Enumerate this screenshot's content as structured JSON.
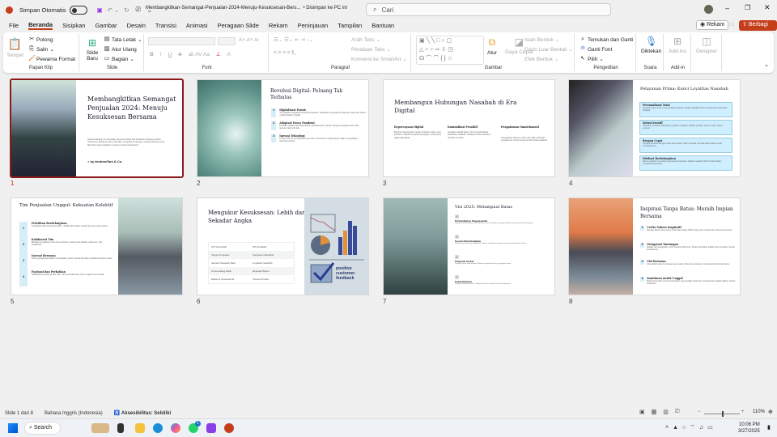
{
  "titlebar": {
    "autosave_label": "Simpan Otomatis",
    "filename": "Membangkitkan-Semangat-Penjualan-2024-Menuju-Kesuksesan-Bers...",
    "save_state": "• Disimpan ke PC ini",
    "search_placeholder": "Cari"
  },
  "tabs": [
    "File",
    "Beranda",
    "Sisipkan",
    "Gambar",
    "Desain",
    "Transisi",
    "Animasi",
    "Peragaan Slide",
    "Rekam",
    "Peninjauan",
    "Tampilan",
    "Bantuan"
  ],
  "actions": {
    "record": "Rekam",
    "share": "Berbagi"
  },
  "ribbon": {
    "clipboard": {
      "paste": "Tempel",
      "cut": "Potong",
      "copy": "Salin",
      "format_painter": "Pewarna Format",
      "label": "Papan Klip"
    },
    "slides": {
      "new_slide": "Slide Baru",
      "layout": "Tata Letak",
      "reset": "Atur Ulang",
      "section": "Bagian",
      "label": "Slide"
    },
    "font": {
      "label": "Font"
    },
    "paragraph": {
      "text_direction": "Arah Teks",
      "align_text": "Perataan Teks",
      "smartart": "Konversi ke SmartArt",
      "label": "Paragraf"
    },
    "drawing": {
      "arrange": "Atur",
      "quick_styles": "Gaya Cepat",
      "shape_fill": "Isian Bentuk",
      "shape_outline": "Garis Luar Bentuk",
      "shape_effects": "Efek Bentuk",
      "label": "Gambar"
    },
    "editing": {
      "find_replace": "Temukan dan Ganti",
      "replace_font": "Ganti Font",
      "select": "Pilih",
      "label": "Pengeditan"
    },
    "voice": {
      "dictate": "Diktekan",
      "label": "Suara"
    },
    "addins": {
      "addins": "Add-ins",
      "label": "Add-in"
    },
    "designer": {
      "designer": "Designer"
    }
  },
  "slides": [
    {
      "number": "1",
      "title": "Membangkitkan Semangat Penjualan 2024: Menuju Kesuksesan Bersama",
      "body": "Selamat datang, tim penjualan yang luar biasa! Kita berada di ambang revolusi perbankan. Bersama-sama, kita akan mengubah tantangan menjadi peluang emas. Mari kita mulai perjalanan menuju puncak kesuksesan!",
      "author": "by AndrewTani & Co."
    },
    {
      "number": "2",
      "title": "Revolusi Digital: Peluang Tak Terbatas",
      "items": [
        {
          "n": "1",
          "h": "Digitalisasi Penuh",
          "t": "Tren digital mengubah lanskap perbankan. Nasabah menginginkan layanan cepat dan efisien melalui platform digital."
        },
        {
          "n": "2",
          "h": "Adaptasi Pasca Pandemi",
          "t": "Perilaku nasabah berubah drastis. Mereka lebih nyaman dengan transaksi online dan layanan tanpa kontak."
        },
        {
          "n": "3",
          "h": "Inovasi Teknologi",
          "t": "Fintech dan AI membuka dimensi baru. Kita harus menjadi pionir dalam mengadopsi teknologi terbaru."
        }
      ]
    },
    {
      "number": "3",
      "title": "Membangun Hubungan Nasabah di Era Digital",
      "cols": [
        {
          "h": "Kepercayaan Digital",
          "t": "Bangun kepercayaan melalui interaksi online yang personal. Jadilah konsultan keuangan virtual yang dapat diandalkan."
        },
        {
          "h": "Komunikasi Proaktif",
          "t": "Gunakan analitik data untuk mengantisipasi kebutuhan nasabah. Tawarkan solusi sebelum mereka meminta."
        },
        {
          "h": "Pengalaman Omnichannel",
          "t": "Integrasikan layanan online dan offline. Berikan pengalaman mulus di semua titik kontak nasabah."
        }
      ]
    },
    {
      "number": "4",
      "title": "Pelayanan Prima: Kunci Loyalitas Nasabah",
      "items": [
        {
          "h": "Personalisasi Total",
          "t": "Gunakan data untuk menyesuaikan layanan. Setiap nasabah harus merasa dimengerti dan dihargai."
        },
        {
          "h": "Solusi Kreatif",
          "t": "Tawarkan produk berdasarkan perilaku nasabah. Jadilah problem solver, bukan hanya penjual."
        },
        {
          "h": "Respon Cepat",
          "t": "Tangani keluhan dengan cepat dan efektif. Ubah masalah menjadi kesempatan untuk mengesankan."
        },
        {
          "h": "Edukasi Berkelanjutan",
          "t": "Bantu nasabah memahami keputusan finansial. Jadikan nasabah lebih cerdas dalam mengelola keuangan."
        }
      ]
    },
    {
      "number": "5",
      "title": "Tim Penjualan Unggul: Kekuatan Kolektif",
      "items": [
        {
          "n": "1",
          "h": "Pelatihan Berkelanjutan",
          "t": "Tingkatkan skill secara konsisten. Jadilah ahli dalam produk dan tren pasar terkini."
        },
        {
          "n": "2",
          "h": "Kolaborasi Tim",
          "t": "Berbagi pengalaman dan best practices. Sukses kita adalah sukses tim, dan sebaliknya."
        },
        {
          "n": "3",
          "h": "Inovasi Bersama",
          "t": "Dorong kreativitas dalam menciptakan solusi. Setiap ide bisa menjadi terobosan besar."
        },
        {
          "n": "4",
          "h": "Evaluasi dan Perbaikan",
          "t": "Refleksikan kinerja secara rutin. Terus perbaiki diri untuk menjadi versi terbaik."
        }
      ]
    },
    {
      "number": "6",
      "title": "Mengukur Kesuksesan: Lebih dari Sekadar Angka",
      "table": [
        [
          "KPI Kuantitatif",
          "KPI Kualitatif"
        ],
        [
          "Target Penjualan",
          "Kepuasan Nasabah"
        ],
        [
          "Akuisisi Nasabah Baru",
          "Loyalitas Nasabah"
        ],
        [
          "Cross-selling Ratio",
          "Reputasi Brand"
        ],
        [
          "Efisiensi Operasional",
          "Inovasi Produk"
        ]
      ],
      "image_text": "positive customer feedback"
    },
    {
      "number": "7",
      "title": "Visi 2025: Melampaui Batas",
      "items": [
        {
          "h": "Pertumbuhan Eksponensial",
          "t": "Targetkan pertumbuhan 200% dalam 2 tahun. Setiap tantangan adalah peluang untuk berkembang."
        },
        {
          "h": "Inovasi Berkelanjutan",
          "t": "Ciptakan produk yang mengubah industri. Jadilah pemimpin, bukan pengikut dalam inovasi."
        },
        {
          "h": "Ekspansi Global",
          "t": "Jangkau pasar internasional. Bawa keunggulan kita ke panggung dunia."
        },
        {
          "h": "Keberlanjutan",
          "t": "Integrasikan prinsip ESG. Jadikan bank kita model bisnis berkelanjutan."
        }
      ]
    },
    {
      "number": "8",
      "title": "Inspirasi Tanpa Batas: Meraih Impian Bersama",
      "items": [
        {
          "n": "1",
          "h": "Cerita Sukses Inspiratif",
          "t": "Dengan kisah rekan yang melampaui target 300%. Apa yang mereka bisa, kita semua bisa!"
        },
        {
          "n": "2",
          "h": "Mengatasi Tantangan",
          "t": "Belajar dari kegagalan untuk bangkit lebih kuat. Setiap hambatan adalah batu loncatan menuju kesuksesan."
        },
        {
          "n": "3",
          "h": "Visi Bersama",
          "t": "Kita adalah satu tim dengan satu tujuan. Bersama, kita akan mencapai hal-hal luar biasa."
        },
        {
          "n": "4",
          "h": "Komitmen untuk Unggul",
          "t": "Berkomitmenlah untuk memberikan yang terbaik setiap hari. Kesuksesan adalah pilihan, bukan kebetulan."
        }
      ]
    }
  ],
  "status": {
    "slide_count": "Slide 1 dari 8",
    "language": "Bahasa Inggris (Indonesia)",
    "accessibility": "Aksesibilitas: Selidiki",
    "zoom": "110%"
  },
  "taskbar": {
    "search": "Search",
    "time": "10:06 PM",
    "date": "3/27/2025",
    "whatsapp_badge": "1"
  },
  "colors": {
    "accent": "#c43e1c",
    "selected_border": "#8b1a1a",
    "card_blue": "#cfeeff"
  }
}
